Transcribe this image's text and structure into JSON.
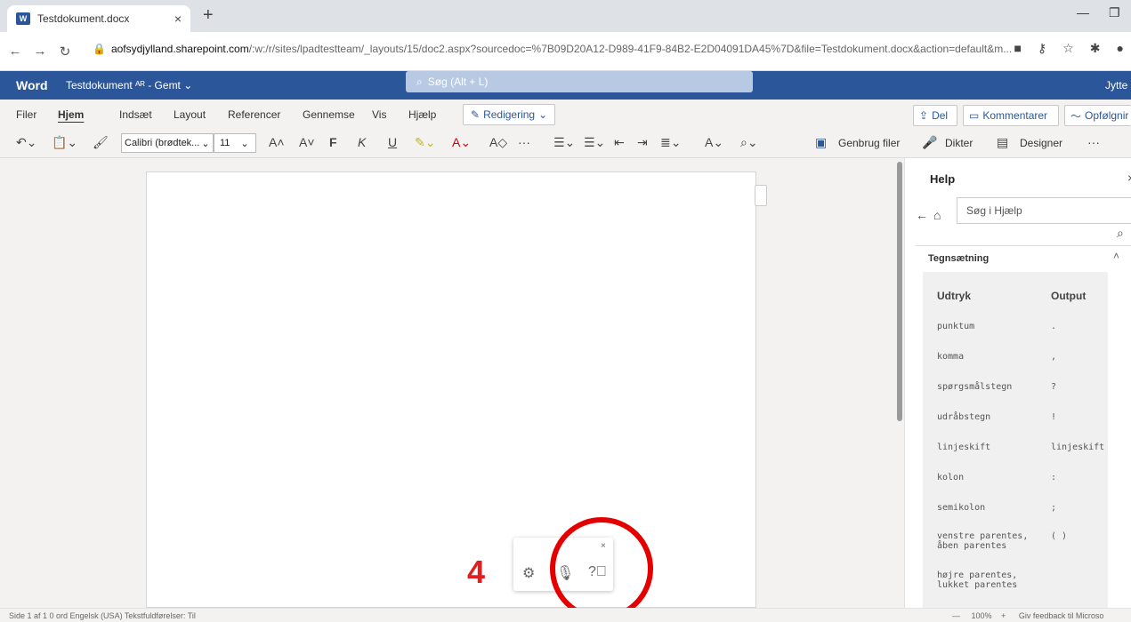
{
  "browser": {
    "tab_title": "Testdokument.docx",
    "tab_close": "×",
    "new_tab": "+",
    "url_domain": "aofsydjylland.sharepoint.com",
    "url_path": "/:w:/r/sites/lpadtestteam/_layouts/15/doc2.aspx?sourcedoc=%7B09D20A12-D989-41F9-84B2-E2D04091DA45%7D&file=Testdokument.docx&action=default&m..."
  },
  "word": {
    "app_name": "Word",
    "doc_name": "Testdokument ᴬᴿ - Gemt  ⌄",
    "search_placeholder": "Søg (Alt + L)",
    "user_name": "Jytte"
  },
  "ribbon": {
    "tabs": [
      "Filer",
      "Hjem",
      "Indsæt",
      "Layout",
      "Referencer",
      "Gennemse",
      "Vis",
      "Hjælp"
    ],
    "active_tab": "Hjem",
    "edit_mode": "Redigering",
    "share": "Del",
    "comments": "Kommentarer",
    "followup": "Opfølgnir"
  },
  "toolbar": {
    "font_name": "Calibri (brødtek...",
    "font_size": "11",
    "reuse_files": "Genbrug filer",
    "dictate": "Dikter",
    "designer": "Designer"
  },
  "help": {
    "title": "Help",
    "search_placeholder": "Søg i Hjælp",
    "section": "Tegnsætning",
    "col_expression": "Udtryk",
    "col_output": "Output",
    "rows": [
      {
        "expr": "punktum",
        "out": "."
      },
      {
        "expr": "komma",
        "out": ","
      },
      {
        "expr": "spørgsmålstegn",
        "out": "?"
      },
      {
        "expr": "udråbstegn",
        "out": "!"
      },
      {
        "expr": "linjeskift",
        "out": "linjeskift"
      },
      {
        "expr": "kolon",
        "out": ":"
      },
      {
        "expr": "semikolon",
        "out": ";"
      },
      {
        "expr": "venstre parentes, åben parentes",
        "out": "( )"
      },
      {
        "expr": "højre parentes, lukket parentes",
        "out": ""
      }
    ]
  },
  "dictation": {
    "close": "×",
    "step_number": "4"
  },
  "status": {
    "left": "Side 1 af 1    0 ord    Engelsk (USA)    Tekstfuldførelser: Til",
    "zoom": "100%",
    "feedback": "Giv feedback til Microso"
  }
}
